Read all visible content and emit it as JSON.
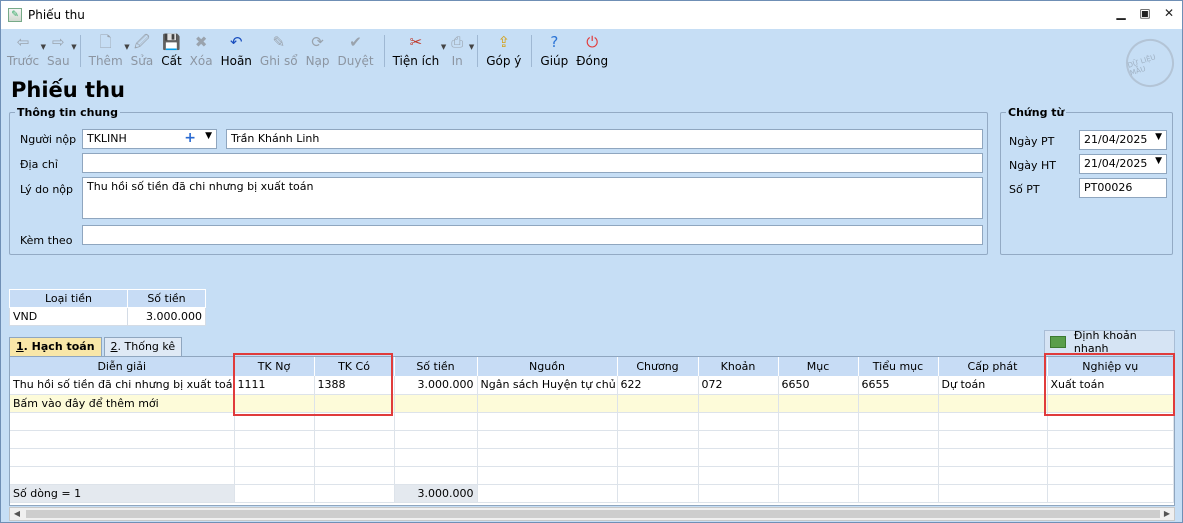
{
  "window": {
    "title": "Phiếu thu"
  },
  "toolbar": [
    {
      "id": "truoc",
      "label": "Trước",
      "icon": "arrow-left-icon",
      "glyph": "⇦",
      "enabled": false,
      "dropdown": true
    },
    {
      "id": "sau",
      "label": "Sau",
      "icon": "arrow-right-icon",
      "glyph": "⇨",
      "enabled": false,
      "dropdown": true
    },
    {
      "id": "them",
      "label": "Thêm",
      "icon": "new-document-icon",
      "glyph": "🗋",
      "enabled": false,
      "dropdown": true
    },
    {
      "id": "sua",
      "label": "Sửa",
      "icon": "edit-document-icon",
      "glyph": "🖉",
      "enabled": false
    },
    {
      "id": "cat",
      "label": "Cất",
      "icon": "save-icon",
      "glyph": "💾",
      "enabled": true
    },
    {
      "id": "xoa",
      "label": "Xóa",
      "icon": "delete-document-icon",
      "glyph": "✖",
      "enabled": false
    },
    {
      "id": "hoan",
      "label": "Hoãn",
      "icon": "undo-icon",
      "glyph": "↶",
      "enabled": true
    },
    {
      "id": "ghiso",
      "label": "Ghi sổ",
      "icon": "pencil-icon",
      "glyph": "✎",
      "enabled": false
    },
    {
      "id": "nap",
      "label": "Nạp",
      "icon": "refresh-icon",
      "glyph": "⟳",
      "enabled": false
    },
    {
      "id": "duyet",
      "label": "Duyệt",
      "icon": "checkmark-icon",
      "glyph": "✔",
      "enabled": false
    },
    {
      "id": "tienich",
      "label": "Tiện ích",
      "icon": "tools-icon",
      "glyph": "✂",
      "enabled": true,
      "dropdown": true
    },
    {
      "id": "in",
      "label": "In",
      "icon": "printer-icon",
      "glyph": "⎙",
      "enabled": false,
      "dropdown": true
    },
    {
      "id": "gopy",
      "label": "Góp ý",
      "icon": "feedback-icon",
      "glyph": "⇪",
      "enabled": true
    },
    {
      "id": "giup",
      "label": "Giúp",
      "icon": "help-icon",
      "glyph": "?",
      "enabled": true
    },
    {
      "id": "dong",
      "label": "Đóng",
      "icon": "power-icon",
      "glyph": "⏻",
      "enabled": true
    }
  ],
  "page_title": "Phiếu thu",
  "general": {
    "legend": "Thông tin chung",
    "payer_label": "Người nộp",
    "payer_code": "TKLINH",
    "payer_name": "Trần Khánh Linh",
    "address_label": "Địa chỉ",
    "address": "",
    "reason_label": "Lý do nộp",
    "reason": "Thu hồi số tiền đã chi nhưng bị xuất toán",
    "attach_label": "Kèm theo",
    "attach": ""
  },
  "voucher": {
    "legend": "Chứng từ",
    "ngay_pt_label": "Ngày PT",
    "ngay_pt": "21/04/2025",
    "ngay_ht_label": "Ngày HT",
    "ngay_ht": "21/04/2025",
    "so_pt_label": "Số PT",
    "so_pt": "PT00026"
  },
  "currency": {
    "headers": [
      "Loại tiền",
      "Số tiền"
    ],
    "type": "VND",
    "amount": "3.000.000"
  },
  "tabs": [
    {
      "num": "1",
      "label": ". Hạch toán",
      "active": true
    },
    {
      "num": "2",
      "label": ". Thống kê",
      "active": false
    }
  ],
  "quick_entry": "Định khoản nhanh",
  "grid": {
    "headers": [
      "Diễn giải",
      "TK Nợ",
      "TK Có",
      "Số tiền",
      "Nguồn",
      "Chương",
      "Khoản",
      "Mục",
      "Tiểu mục",
      "Cấp phát",
      "Nghiệp vụ"
    ],
    "rows": [
      [
        "Thu hồi số tiền đã chi nhưng bị xuất toán",
        "1111",
        "1388",
        "3.000.000",
        "Ngân sách Huyện tự chủ",
        "622",
        "072",
        "6650",
        "6655",
        "Dự toán",
        "Xuất toán"
      ]
    ],
    "new_row": "Bấm vào đây để thêm mới",
    "footer_count": "Số dòng = 1",
    "footer_total": "3.000.000"
  },
  "highlight_color": "#e03b3b"
}
